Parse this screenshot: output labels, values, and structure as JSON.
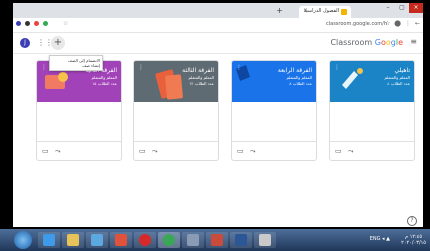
{
  "browser": {
    "tab_title": "الفصول الدراسية",
    "new_tab": "+",
    "tab_close": "×",
    "window_buttons": [
      "–",
      "▢",
      "×"
    ],
    "url": "classroom.google.com/h",
    "star": "☆",
    "toolbar_right": [
      "☆",
      "⬤",
      "⋮",
      "←"
    ]
  },
  "header": {
    "avatar_letter": "J",
    "apps_icon": "apps-grid",
    "add_symbol": "+",
    "brand_prefix": "Classroom ",
    "brand_letters": [
      "G",
      "o",
      "o",
      "g",
      "l",
      "e"
    ],
    "menu_icon": "hamburger"
  },
  "tooltip": {
    "lines": [
      "الانضمام إلى الصف",
      "إنشاء صف"
    ]
  },
  "cards": [
    {
      "name": "الفرقة الثانية",
      "subtitle": "المعلم والمتعلم",
      "meta": "عدد الطلاب ١٥",
      "color": "#a142b8"
    },
    {
      "name": "الفرقة الثالثة",
      "subtitle": "المعلم والمتعلم",
      "meta": "عدد الطلاب ١٢",
      "color": "#5f6b73"
    },
    {
      "name": "الفرقة الرابعة",
      "subtitle": "المعلم والمتعلم",
      "meta": "عدد الطلاب ٨",
      "color": "#1a73e8"
    },
    {
      "name": "تاهيلي",
      "subtitle": "المعلم والمتعلم",
      "meta": "عدد الطلاب ٤",
      "color": "#1a84c7"
    }
  ],
  "footer_icons": [
    "folder-icon",
    "trend-icon"
  ],
  "help": "?",
  "taskbar": {
    "clock_time": "١٢:٤٥ م",
    "clock_date": "٢٠٢٠/٠٣/١٥",
    "tray_text": "ENG ◂ ▲"
  }
}
